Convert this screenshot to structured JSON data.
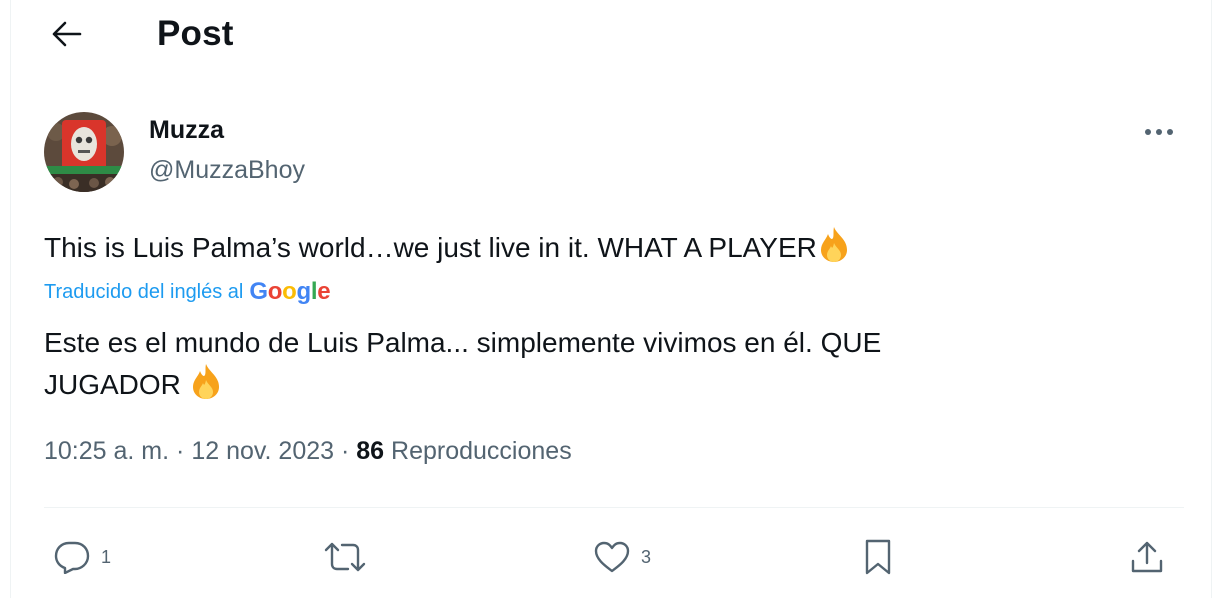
{
  "header": {
    "title": "Post",
    "back_icon": "arrow-left-icon"
  },
  "author": {
    "display_name": "Muzza",
    "handle": "@MuzzaBhoy",
    "avatar_icon": "avatar-image"
  },
  "tweet": {
    "text": "This is Luis Palma’s world…we just live in it. WHAT A PLAYER",
    "emoji": "fire-emoji",
    "translated_label": "Traducido del inglés al",
    "translator_logo": [
      "G",
      "o",
      "o",
      "g",
      "l",
      "e"
    ],
    "translator_logo_colors": [
      "#4285F4",
      "#EA4335",
      "#FBBC05",
      "#4285F4",
      "#34A853",
      "#EA4335"
    ],
    "translation_line1": "Este es el mundo de Luis Palma... simplemente vivimos en él. QUE",
    "translation_line2": "JUGADOR"
  },
  "meta": {
    "time": "10:25 a. m.",
    "separator": "·",
    "date": "12 nov. 2023",
    "views_count": "86",
    "views_label": "Reproducciones"
  },
  "actions": {
    "reply_count": "1",
    "like_count": "3"
  },
  "colors": {
    "accent": "#1d9bf0",
    "text_primary": "#0f1419",
    "text_secondary": "#536471",
    "divider": "#eff3f4"
  }
}
